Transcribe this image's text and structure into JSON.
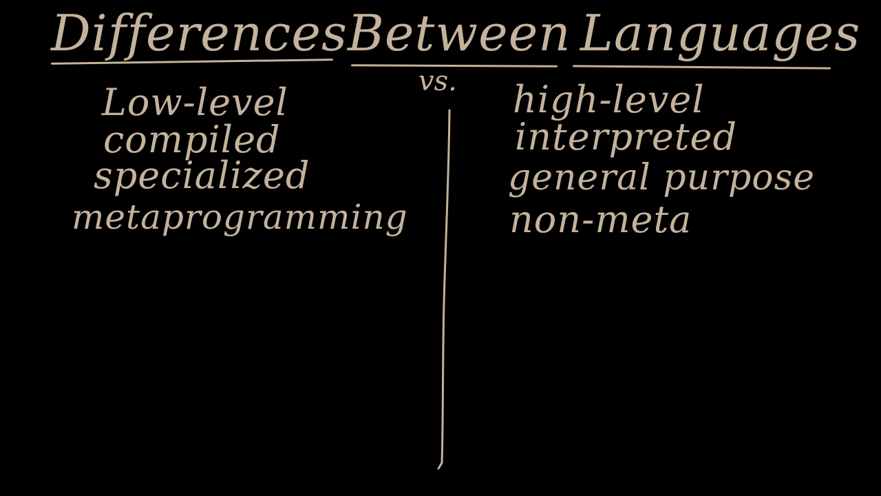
{
  "board": {
    "ink_color": "#c4b29c",
    "background_color": "#000000",
    "title_words": [
      "Differences",
      "Between",
      "Languages"
    ],
    "separator": "vs.",
    "left_items": [
      "Low-level",
      "compiled",
      "specialized",
      "metaprogramming"
    ],
    "right_items": [
      "high-level",
      "interpreted",
      "general purpose",
      "non-meta"
    ]
  }
}
